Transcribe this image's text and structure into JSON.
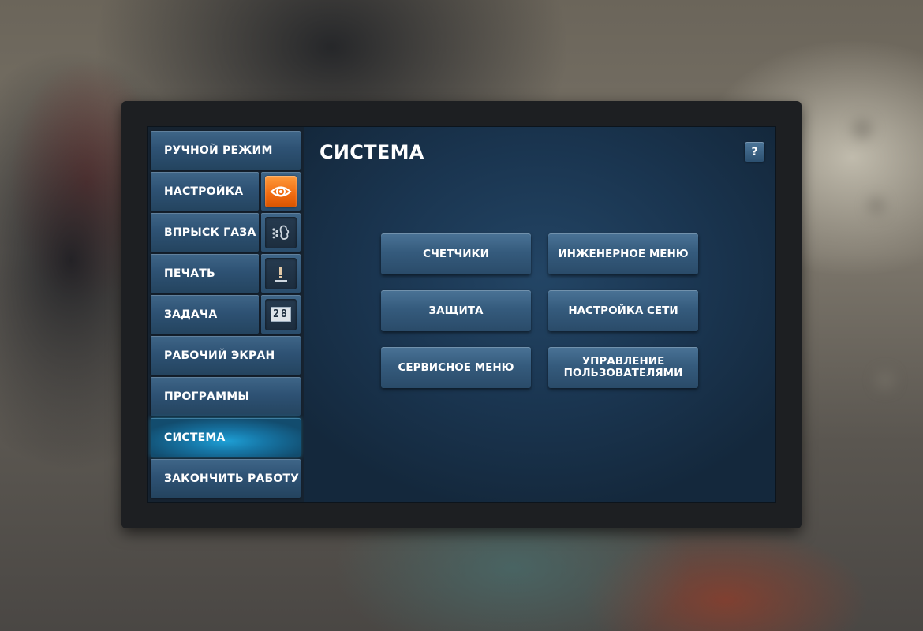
{
  "title": "СИСТЕМА",
  "help_label": "?",
  "sidebar": {
    "items": [
      {
        "label": "РУЧНОЙ РЕЖИМ"
      },
      {
        "label": "НАСТРОЙКА",
        "icon": "camera-eye-icon"
      },
      {
        "label": "ВПРЫСК ГАЗА",
        "icon": "gas-cloud-icon"
      },
      {
        "label": "ПЕЧАТЬ",
        "icon": "print-stamp-icon"
      },
      {
        "label": "ЗАДАЧА",
        "icon": "counter-icon",
        "icon_text": "28"
      },
      {
        "label": "РАБОЧИЙ ЭКРАН"
      },
      {
        "label": "ПРОГРАММЫ"
      },
      {
        "label": "СИСТЕМА",
        "active": true
      },
      {
        "label": "ЗАКОНЧИТЬ РАБОТУ"
      }
    ]
  },
  "actions": [
    {
      "label": "СЧЕТЧИКИ"
    },
    {
      "label": "ИНЖЕНЕРНОЕ МЕНЮ"
    },
    {
      "label": "ЗАЩИТА"
    },
    {
      "label": "НАСТРОЙКА СЕТИ"
    },
    {
      "label": "СЕРВИСНОЕ МЕНЮ"
    },
    {
      "label": "УПРАВЛЕНИЕ ПОЛЬЗОВАТЕЛЯМИ"
    }
  ],
  "colors": {
    "accent_active": "#1ea0d6",
    "icon_highlight": "#f06a10",
    "button_base": "#355b7d",
    "panel_bg": "#1a3550"
  }
}
